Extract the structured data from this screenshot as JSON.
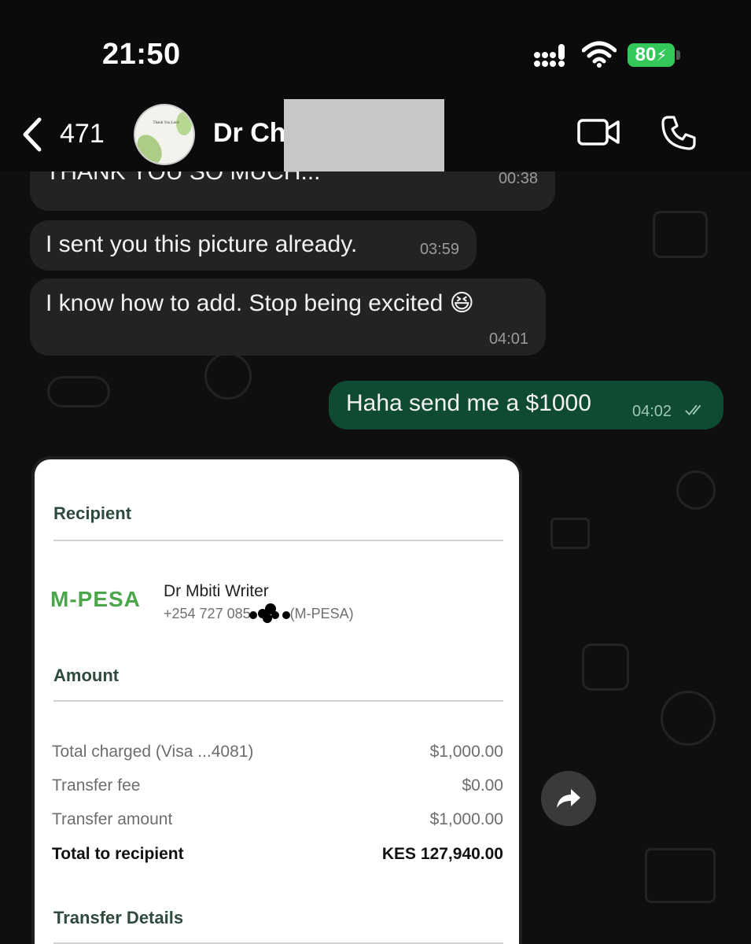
{
  "status_bar": {
    "time": "21:50",
    "battery": "80",
    "icons": [
      "signal-icon",
      "wifi-icon",
      "battery-charging-icon"
    ]
  },
  "header": {
    "back_count": "471",
    "contact_name": "Dr Ch",
    "avatar_text": "Thank You Lord",
    "icons": [
      "chevron-left-icon",
      "video-call-icon",
      "phone-call-icon"
    ]
  },
  "messages": [
    {
      "direction": "in",
      "text": "THANK YOU SO MUCH...",
      "time": "00:38"
    },
    {
      "direction": "in",
      "text": "I sent you this picture already.",
      "time": "03:59"
    },
    {
      "direction": "in",
      "text": "I know how to add. Stop being excited 😆",
      "time": "04:01"
    },
    {
      "direction": "out",
      "text": "Haha send me a $1000",
      "time": "04:02",
      "status": "read"
    }
  ],
  "receipt": {
    "recipient_title": "Recipient",
    "logo_text": "M-PESA",
    "recipient_name": "Dr Mbiti Writer",
    "recipient_phone": "+254 727 085",
    "recipient_phone_suffix": "(M-PESA)",
    "amount_title": "Amount",
    "rows": [
      {
        "label": "Total charged (Visa ...4081)",
        "value": "$1,000.00"
      },
      {
        "label": "Transfer fee",
        "value": "$0.00"
      },
      {
        "label": "Transfer amount",
        "value": "$1,000.00"
      },
      {
        "label": "Total to recipient",
        "value": "KES 127,940.00"
      }
    ],
    "transfer_details_title": "Transfer Details"
  },
  "colors": {
    "outgoing_bubble": "#0f4a32",
    "incoming_bubble": "#232323",
    "battery": "#34c759",
    "mpesa_green": "#4aa649"
  }
}
